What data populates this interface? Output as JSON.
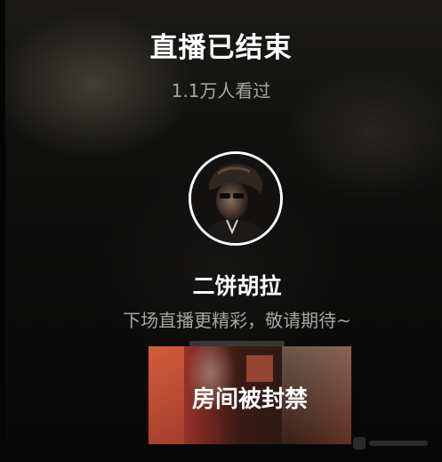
{
  "live_ended": {
    "title": "直播已结束",
    "viewers_text": "1.1万人看过"
  },
  "streamer": {
    "name": "二饼胡拉",
    "next_stream_text": "下场直播更精彩，敬请期待~",
    "avatar_icon": "avatar-photo"
  },
  "banned_card": {
    "label": "房间被封禁"
  },
  "colors": {
    "background": "#0b0b0b",
    "primary_text": "#ffffff",
    "secondary_text": "#a9a7a3",
    "banned_card_accent": "#c04a3a"
  }
}
